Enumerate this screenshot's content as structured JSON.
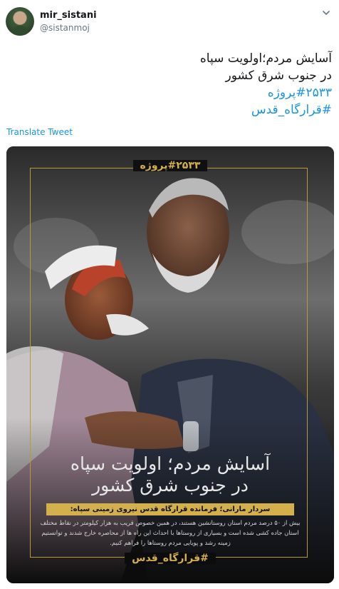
{
  "user": {
    "display_name": "mir_sistani",
    "handle": "@sistanmoj"
  },
  "tweet": {
    "lines": [
      "آسایش مردم؛اولویت سپاه",
      "در جنوب شرق کشور",
      "#۲۵۳۳پروژه",
      "#قرارگاه_قدس"
    ],
    "translate_label": "Translate Tweet"
  },
  "image": {
    "top_hashtag": "#۲۵۳۳پروژه",
    "headline_line1": "آسایش مردم؛ اولویت سپاه",
    "headline_line2": "در جنوب شرق کشور",
    "subheading": "سردار مارانی؛ فرمانده قرارگاه قدس نیروی زمینی سپاه:",
    "quote": "بیش از ۵۰ درصد مردم استان روستانشین هستند، در همین خصوص قریب به هزار کیلومتر در نقاط مختلف استان جاده کشی شده است و بسیاری از روستاها با احداث این راه ها از محاصره خارج شدند و توانستیم زمینه رشد و پویایی مردم روستاها را فراهم کنیم.",
    "bottom_hashtag": "#قرارگاه_قدس"
  },
  "colors": {
    "link": "#1b95e0",
    "gold": "#d4b04c",
    "name": "#14171a",
    "muted": "#657786"
  },
  "icons": [
    "avatar",
    "chevron-down-icon"
  ]
}
